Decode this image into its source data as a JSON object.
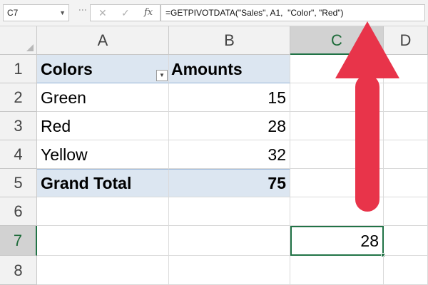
{
  "formula_bar": {
    "name_box": "C7",
    "formula": "=GETPIVOTDATA(\"Sales\", A1,  \"Color\", \"Red\")",
    "cancel_icon": "x-icon",
    "enter_icon": "check-icon",
    "fx_label": "fx"
  },
  "columns": [
    "A",
    "B",
    "C",
    "D"
  ],
  "rows": [
    "1",
    "2",
    "3",
    "4",
    "5",
    "6",
    "7",
    "8"
  ],
  "pivot": {
    "header_label": "Colors",
    "header_value": "Amounts",
    "items": [
      {
        "label": "Green",
        "value": "15"
      },
      {
        "label": "Red",
        "value": "28"
      },
      {
        "label": "Yellow",
        "value": "32"
      }
    ],
    "total_label": "Grand Total",
    "total_value": "75"
  },
  "selected_cell": {
    "ref": "C7",
    "value": "28"
  },
  "colors": {
    "pivot_fill": "#dce6f1",
    "selection_green": "#217346",
    "arrow_red": "#e8344a"
  }
}
